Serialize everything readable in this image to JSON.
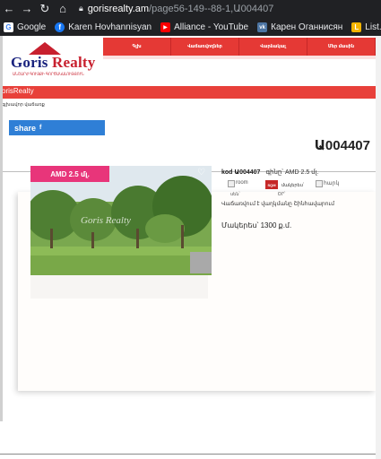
{
  "browser": {
    "url_host": "gorisrealty.am",
    "url_path": "/page56-149--88-1,Ա004407",
    "bookmarks": [
      {
        "label": "Google",
        "icon": "google-icon",
        "color": "#4285f4",
        "glyph": "G"
      },
      {
        "label": "Karen Hovhannisyan",
        "icon": "facebook-icon",
        "color": "#1877f2",
        "glyph": "f"
      },
      {
        "label": "Alliance - YouTube",
        "icon": "youtube-icon",
        "color": "#ff0000",
        "glyph": "▶"
      },
      {
        "label": "Карен Оганнисян",
        "icon": "vk-icon",
        "color": "#4c75a3",
        "glyph": "vk"
      },
      {
        "label": "List.am - Հայտարար",
        "icon": "listam-icon",
        "color": "#f4b400",
        "glyph": "L"
      }
    ]
  },
  "site": {
    "logo_text_a": "Goris",
    "logo_text_b": " Realty",
    "logo_sub": "ԱՆՇԱՐԺ ԳՈՒՅՔԻ ԳՈՐԾԱԿԱԼՈՒԹՅՈՒՆ",
    "nav": [
      "Գլխ",
      "Վաճառվողներ",
      "Վարձակալ",
      "Մեր մասին"
    ],
    "redbar": "orisRealty",
    "breadcrumb": "գլխավոր վաճառք",
    "share_label": "share",
    "share_icon": "f"
  },
  "listing": {
    "code_title": "Ա004407",
    "price_badge": "AMD 2.5 մլ.",
    "watermark": "Goris Realty",
    "kod": "kod Ա004407",
    "price_line": "գինը՝ AMD 2.5 մլ.",
    "room_label": "room",
    "sqm_badge": "SQM",
    "sqm_label": "մակերես՝",
    "floor_label": "հարկ",
    "room_sub": "սեն՝",
    "floor_sub": "ՕՐ՝",
    "description": "Վաճառվում է վաղկմանը Շինհավարում",
    "area": "Մակերես՝ 1300 ք.մ."
  }
}
